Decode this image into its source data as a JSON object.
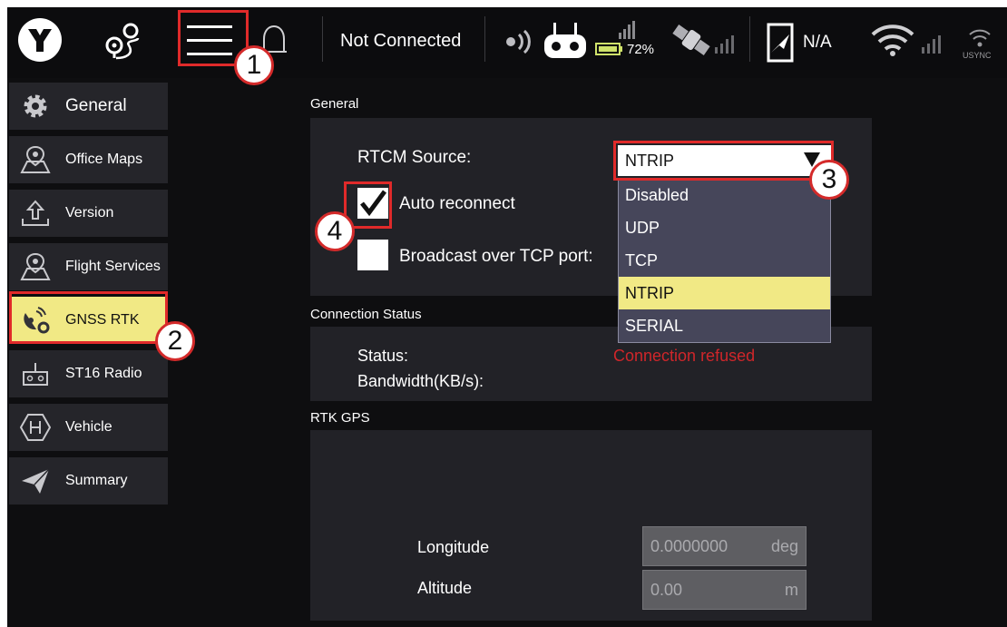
{
  "toolbar": {
    "connection_status": "Not Connected",
    "battery_percent": "72%",
    "flight_state": "N/A",
    "usync_label": "USYNC"
  },
  "sidebar": {
    "items": [
      {
        "label": "General",
        "icon": "gear-icon"
      },
      {
        "label": "Office Maps",
        "icon": "map-pin-icon"
      },
      {
        "label": "Version",
        "icon": "upload-icon"
      },
      {
        "label": "Flight Services",
        "icon": "map-pin-icon"
      },
      {
        "label": "GNSS RTK",
        "icon": "satellite-gear-icon"
      },
      {
        "label": "ST16 Radio",
        "icon": "radio-controller-icon"
      },
      {
        "label": "Vehicle",
        "icon": "hexagon-h-icon"
      },
      {
        "label": "Summary",
        "icon": "paper-plane-icon"
      }
    ],
    "active_index": 4
  },
  "general": {
    "title": "General",
    "rtcm_source_label": "RTCM Source:",
    "rtcm_source_value": "NTRIP",
    "rtcm_options": [
      "Disabled",
      "UDP",
      "TCP",
      "NTRIP",
      "SERIAL"
    ],
    "rtcm_selected_index": 3,
    "auto_reconnect_label": "Auto reconnect",
    "auto_reconnect_checked": true,
    "broadcast_label": "Broadcast over TCP port:",
    "broadcast_checked": false
  },
  "connection": {
    "title": "Connection Status",
    "status_label": "Status:",
    "status_value": "Connection refused",
    "bandwidth_label": "Bandwidth(KB/s):"
  },
  "rtk_gps": {
    "title": "RTK GPS",
    "longitude_label": "Longitude",
    "longitude_value": "0.0000000",
    "longitude_unit": "deg",
    "altitude_label": "Altitude",
    "altitude_value": "0.00",
    "altitude_unit": "m"
  },
  "callouts": [
    "1",
    "2",
    "3",
    "4"
  ],
  "colors": {
    "background": "#0e0e10",
    "panel": "#222227",
    "active_item": "#f1e985",
    "error": "#d0262a",
    "callout_red": "#e02a2a"
  }
}
